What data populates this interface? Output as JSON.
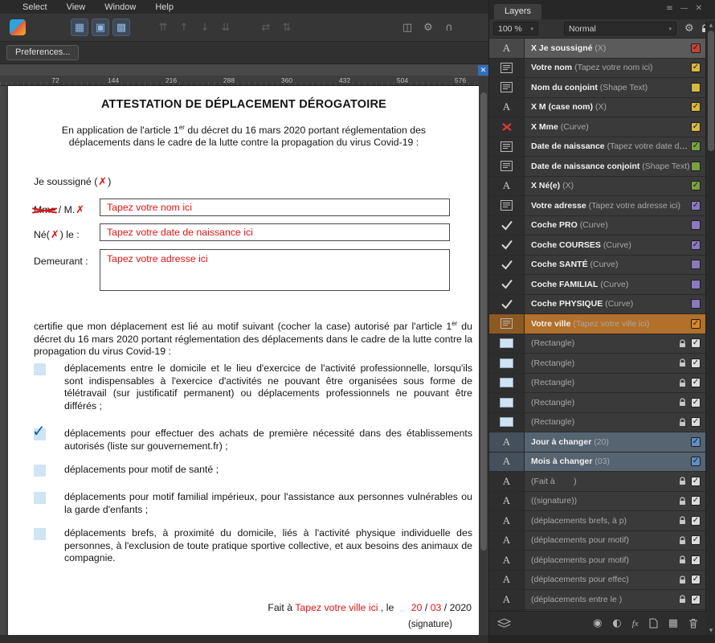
{
  "colors": {
    "tags": {
      "red": "#c94136",
      "yellow": "#d9b83f",
      "green": "#7aa13f",
      "purple": "#8a78c0",
      "orange": "#d78a2b",
      "blue": "#5d8fc4",
      "none": "#dcdcdc"
    },
    "selection": {
      "gray": "#5b5b5b",
      "orange": "#b2702a",
      "blue": "#566472"
    },
    "red_ink": "#d61414",
    "placeholder_red": "#e01414",
    "check_blue": "#0f5fae",
    "motif_checkbox": "#cfe4f4",
    "canvas_close_blue": "#2f6fbd"
  },
  "icons": {
    "close": "✕",
    "panel-menu": "≡",
    "minimize": "—",
    "caret": "▾",
    "gear": "⚙",
    "scroll-up": "▲",
    "scroll-down": "▼",
    "check": "✓",
    "x-mark": "✗"
  },
  "menubar": {
    "items": [
      "Select",
      "View",
      "Window",
      "Help"
    ]
  },
  "toolbar": {
    "preferences_label": "Preferences...",
    "groups": [
      {
        "style": "logo",
        "items": [
          {
            "name": "affinity-logo-icon",
            "glyph": ""
          }
        ]
      },
      {
        "style": "blue",
        "items": [
          {
            "name": "grid-icon",
            "glyph": "▦"
          },
          {
            "name": "marquee-icon",
            "glyph": "▣"
          },
          {
            "name": "transform-icon",
            "glyph": "▩"
          }
        ]
      },
      {
        "style": "dim",
        "items": [
          {
            "name": "move-to-front-icon",
            "glyph": "⇈"
          },
          {
            "name": "move-forward-icon",
            "glyph": "↑"
          },
          {
            "name": "move-backward-icon",
            "glyph": "↓"
          },
          {
            "name": "move-to-back-icon",
            "glyph": "⇊"
          }
        ]
      },
      {
        "style": "dim",
        "items": [
          {
            "name": "align-horizontal-icon",
            "glyph": "⇄"
          },
          {
            "name": "align-vertical-icon",
            "glyph": "⇅"
          }
        ]
      },
      {
        "style": "grey",
        "items": [
          {
            "name": "insert-inside-icon",
            "glyph": "◫"
          },
          {
            "name": "assistant-icon",
            "glyph": "⚙"
          },
          {
            "name": "snapping-icon",
            "glyph": "∩"
          }
        ]
      }
    ]
  },
  "ruler": {
    "ticks": [
      "72",
      "144",
      "216",
      "288",
      "360",
      "432",
      "504",
      "576"
    ]
  },
  "document": {
    "title": "ATTESTATION DE DÉPLACEMENT DÉROGATOIRE",
    "intro_before": "En application de l'article 1",
    "intro_sup": "er",
    "intro_after": " du décret du 16 mars 2020 portant réglementation des déplacements dans le cadre de la lutte contre la propagation du virus Covid-19 :",
    "je_soussigne_before": "Je soussigné (",
    "je_soussigne_after": ")",
    "mme": "Mme",
    "slash_m": " / M.",
    "name_field": {
      "placeholder": "Tapez votre nom ici"
    },
    "ne_before": "Né(",
    "ne_after": ") le :",
    "birth_field": {
      "placeholder": "Tapez votre date de naissance ici"
    },
    "demeurant_label": "Demeurant :",
    "address_field": {
      "placeholder": "Tapez votre adresse ici"
    },
    "certifie_before": "certifie que mon déplacement est lié au motif suivant (cocher la case) autorisé par l'article 1",
    "certifie_sup": "er",
    "certifie_after": " du décret du 16 mars 2020 portant réglementation des déplacements dans le cadre de la lutte contre la propagation du virus Covid-19 :",
    "motifs": [
      {
        "checked": false,
        "text": "déplacements entre le domicile et le lieu d'exercice de l'activité professionnelle, lorsqu'ils sont indispensables à l'exercice d'activités ne pouvant être organisées sous forme de télétravail (sur justificatif permanent) ou déplacements professionnels ne pouvant être différés ;"
      },
      {
        "checked": true,
        "text": "déplacements pour effectuer des achats de première nécessité dans des établissements autorisés (liste sur gouvernement.fr) ;"
      },
      {
        "checked": false,
        "text": "déplacements pour motif de santé ;"
      },
      {
        "checked": false,
        "text": "déplacements pour motif familial impérieux, pour l'assistance aux personnes vulnérables ou la garde d'enfants ;"
      },
      {
        "checked": false,
        "text": "déplacements brefs, à proximité du domicile, liés à l'activité physique individuelle des personnes, à l'exclusion de toute pratique sportive collective, et aux besoins des animaux de compagnie."
      }
    ],
    "footer": {
      "fait_a": "Fait à",
      "city_placeholder": "Tapez votre ville ici",
      "le": ", le",
      "day": "20",
      "slash1": "/",
      "month": "03",
      "slash2": "/",
      "year": "2020",
      "signature": "(signature)"
    }
  },
  "layers_panel": {
    "tab": "Layers",
    "opacity_value": "100 %",
    "blend_mode": "Normal",
    "rows": [
      {
        "name": "X Je soussigné",
        "desc": "(X)",
        "icon": "art-text",
        "tag": "red",
        "checked": true,
        "locked": false,
        "selected": "gray"
      },
      {
        "name": "Votre nom",
        "desc": "(Tapez votre nom ici)",
        "icon": "frame-text",
        "tag": "yellow",
        "checked": true,
        "locked": false,
        "selected": null
      },
      {
        "name": "Nom du conjoint",
        "desc": "(Shape Text)",
        "icon": "frame-text",
        "tag": "yellow",
        "checked": false,
        "locked": false,
        "selected": null
      },
      {
        "name": "X M (case nom)",
        "desc": "(X)",
        "icon": "art-text",
        "tag": "yellow",
        "checked": true,
        "locked": false,
        "selected": null
      },
      {
        "name": "X Mme",
        "desc": "(Curve)",
        "icon": "curve-x",
        "tag": "yellow",
        "checked": true,
        "locked": false,
        "selected": null
      },
      {
        "name": "Date de naissance",
        "desc": "(Tapez votre date de naissance ici)",
        "icon": "frame-text",
        "tag": "green",
        "checked": true,
        "locked": false,
        "selected": null
      },
      {
        "name": "Date de naissance conjoint",
        "desc": "(Shape Text)",
        "icon": "frame-text",
        "tag": "green",
        "checked": false,
        "locked": false,
        "selected": null
      },
      {
        "name": "X Né(e)",
        "desc": "(X)",
        "icon": "art-text",
        "tag": "green",
        "checked": true,
        "locked": false,
        "selected": null
      },
      {
        "name": "Votre adresse",
        "desc": "(Tapez votre adresse ici)",
        "icon": "frame-text",
        "tag": "purple",
        "checked": true,
        "locked": false,
        "selected": null
      },
      {
        "name": "Coche PRO",
        "desc": "(Curve)",
        "icon": "curve-check",
        "tag": "purple",
        "checked": false,
        "locked": false,
        "selected": null
      },
      {
        "name": "Coche COURSES",
        "desc": "(Curve)",
        "icon": "curve-check",
        "tag": "purple",
        "checked": true,
        "locked": false,
        "selected": null
      },
      {
        "name": "Coche SANTÉ",
        "desc": "(Curve)",
        "icon": "curve-check",
        "tag": "purple",
        "checked": false,
        "locked": false,
        "selected": null
      },
      {
        "name": "Coche FAMILIAL",
        "desc": "(Curve)",
        "icon": "curve-check",
        "tag": "purple",
        "checked": false,
        "locked": false,
        "selected": null
      },
      {
        "name": "Coche PHYSIQUE",
        "desc": "(Curve)",
        "icon": "curve-check",
        "tag": "purple",
        "checked": false,
        "locked": false,
        "selected": null
      },
      {
        "name": "Votre ville",
        "desc": "(Tapez votre ville ici)",
        "icon": "frame-text",
        "tag": "orange",
        "checked": true,
        "locked": false,
        "selected": "orange"
      },
      {
        "name": "",
        "desc": "(Rectangle)",
        "icon": "rect",
        "tag": null,
        "checked": true,
        "locked": true,
        "selected": null
      },
      {
        "name": "",
        "desc": "(Rectangle)",
        "icon": "rect",
        "tag": null,
        "checked": true,
        "locked": true,
        "selected": null
      },
      {
        "name": "",
        "desc": "(Rectangle)",
        "icon": "rect",
        "tag": null,
        "checked": true,
        "locked": true,
        "selected": null
      },
      {
        "name": "",
        "desc": "(Rectangle)",
        "icon": "rect",
        "tag": null,
        "checked": true,
        "locked": true,
        "selected": null
      },
      {
        "name": "",
        "desc": "(Rectangle)",
        "icon": "rect",
        "tag": null,
        "checked": true,
        "locked": true,
        "selected": null
      },
      {
        "name": "Jour à changer",
        "desc": "(20)",
        "icon": "art-text",
        "tag": "blue",
        "checked": true,
        "locked": false,
        "selected": "blue"
      },
      {
        "name": "Mois à changer",
        "desc": "(03)",
        "icon": "art-text",
        "tag": "blue",
        "checked": true,
        "locked": false,
        "selected": "blue"
      },
      {
        "name": "",
        "desc": "(Fait à        )",
        "icon": "art-text",
        "tag": null,
        "checked": true,
        "locked": true,
        "selected": null
      },
      {
        "name": "",
        "desc": "((signature))",
        "icon": "art-text",
        "tag": null,
        "checked": true,
        "locked": true,
        "selected": null
      },
      {
        "name": "",
        "desc": "(déplacements brefs, à p)",
        "icon": "art-text",
        "tag": null,
        "checked": true,
        "locked": true,
        "selected": null
      },
      {
        "name": "",
        "desc": "(déplacements pour motif)",
        "icon": "art-text",
        "tag": null,
        "checked": true,
        "locked": true,
        "selected": null
      },
      {
        "name": "",
        "desc": "(déplacements pour motif)",
        "icon": "art-text",
        "tag": null,
        "checked": true,
        "locked": true,
        "selected": null
      },
      {
        "name": "",
        "desc": "(déplacements pour effec)",
        "icon": "art-text",
        "tag": null,
        "checked": true,
        "locked": true,
        "selected": null
      },
      {
        "name": "",
        "desc": "(déplacements entre le )",
        "icon": "art-text",
        "tag": null,
        "checked": true,
        "locked": true,
        "selected": null
      },
      {
        "name": "",
        "desc": "",
        "icon": "art-text",
        "tag": null,
        "checked": true,
        "locked": true,
        "selected": null
      }
    ],
    "bottom_icons": [
      {
        "name": "layers-stack-icon"
      },
      {
        "name": "adjustment-icon",
        "glyph": "◉"
      },
      {
        "name": "mask-icon",
        "glyph": "◐"
      },
      {
        "name": "effects-icon",
        "glyph": "fx"
      },
      {
        "name": "new-layer-icon"
      },
      {
        "name": "new-group-icon",
        "glyph": "▦"
      },
      {
        "name": "delete-icon"
      }
    ]
  }
}
